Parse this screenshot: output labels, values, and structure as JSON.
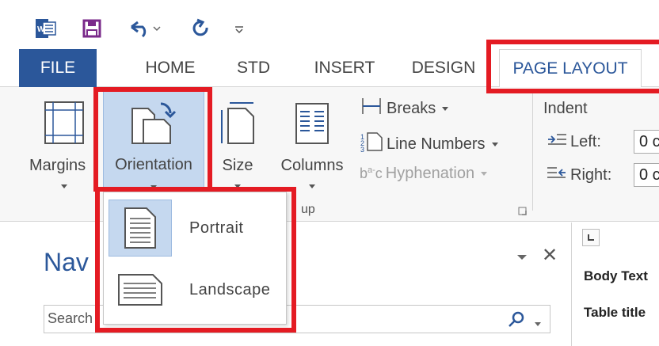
{
  "qat": {
    "icons": [
      "word-icon",
      "save-icon",
      "undo-icon",
      "redo-icon",
      "customize-icon"
    ]
  },
  "tabs": {
    "file": "FILE",
    "home": "HOME",
    "std": "STD",
    "insert": "INSERT",
    "design": "DESIGN",
    "page_layout": "PAGE LAYOUT"
  },
  "ribbon": {
    "margins": "Margins",
    "orientation": "Orientation",
    "size": "Size",
    "columns": "Columns",
    "breaks": "Breaks",
    "line_numbers": "Line Numbers",
    "hyphenation": "Hyphenation",
    "group_label_partial": "up",
    "indent_title": "Indent",
    "indent_left_label": "Left:",
    "indent_left_value": "0 c",
    "indent_right_label": "Right:",
    "indent_right_value": "0 c"
  },
  "dropdown": {
    "portrait": "Portrait",
    "landscape": "Landscape"
  },
  "nav": {
    "title_partial": "Nav",
    "search_placeholder": "Search"
  },
  "styles": {
    "body_text": "Body Text",
    "table_title": "Table title"
  },
  "colors": {
    "accent": "#2b579a",
    "highlight": "#e41b23"
  }
}
